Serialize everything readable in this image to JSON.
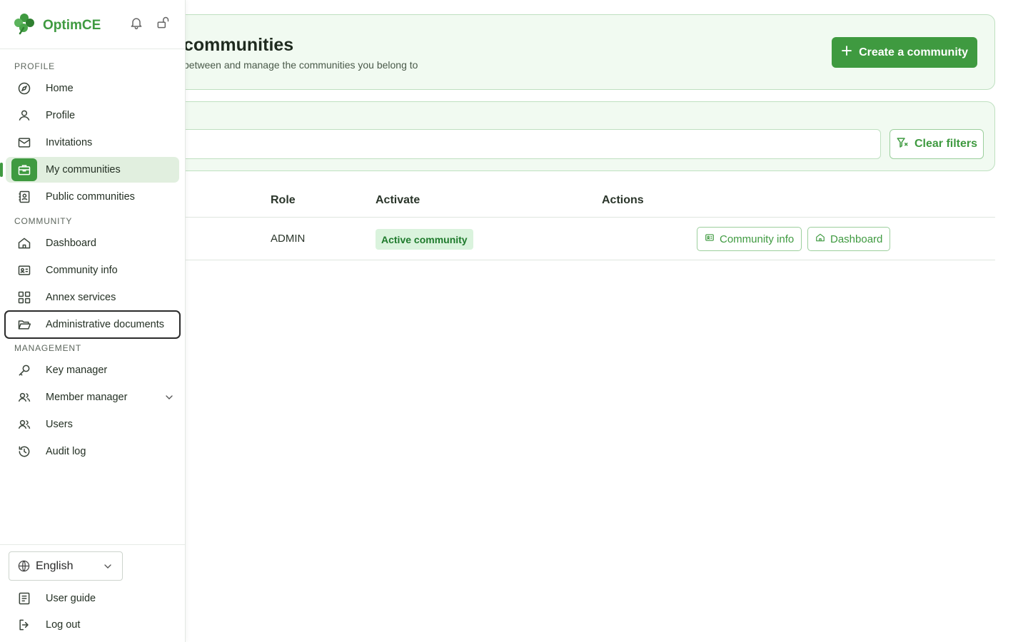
{
  "app": {
    "name": "OptimCE"
  },
  "topbar_icons": [
    "bell-icon",
    "unlock-icon"
  ],
  "sidebar": {
    "sections": {
      "profile": "PROFILE",
      "community": "COMMUNITY",
      "management": "MANAGEMENT"
    },
    "profile_items": [
      {
        "label": "Home",
        "icon": "compass-icon"
      },
      {
        "label": "Profile",
        "icon": "user-icon"
      },
      {
        "label": "Invitations",
        "icon": "mail-icon"
      },
      {
        "label": "My communities",
        "icon": "briefcase-icon",
        "active": true
      },
      {
        "label": "Public communities",
        "icon": "contact-book-icon"
      }
    ],
    "community_items": [
      {
        "label": "Dashboard",
        "icon": "home-icon"
      },
      {
        "label": "Community info",
        "icon": "id-card-icon"
      },
      {
        "label": "Annex services",
        "icon": "grid-icon"
      },
      {
        "label": "Administrative documents",
        "icon": "folder-open-icon",
        "focused": true
      }
    ],
    "management_items": [
      {
        "label": "Key manager",
        "icon": "key-icon"
      },
      {
        "label": "Member manager",
        "icon": "users-icon",
        "expandable": true
      },
      {
        "label": "Users",
        "icon": "users-icon"
      },
      {
        "label": "Audit log",
        "icon": "history-icon"
      }
    ],
    "language": {
      "value": "English"
    },
    "bottom_links": [
      {
        "label": "User guide",
        "icon": "book-icon"
      },
      {
        "label": "Log out",
        "icon": "logout-icon"
      }
    ]
  },
  "header": {
    "title": "My communities",
    "title_visible": "communities",
    "subtitle_visible": "between and manage the communities you belong to",
    "create_button": "Create a community"
  },
  "filters": {
    "search_value": "",
    "clear_button": "Clear filters"
  },
  "table": {
    "columns": [
      "Role",
      "Activate",
      "Actions"
    ],
    "rows": [
      {
        "role": "ADMIN",
        "status": "Active community",
        "actions": [
          "Community info",
          "Dashboard"
        ]
      }
    ]
  },
  "colors": {
    "brand_green": "#3f9a40",
    "card_bg": "#f1faf1",
    "badge_bg": "#daf3dd",
    "badge_text": "#1e7a2c"
  }
}
